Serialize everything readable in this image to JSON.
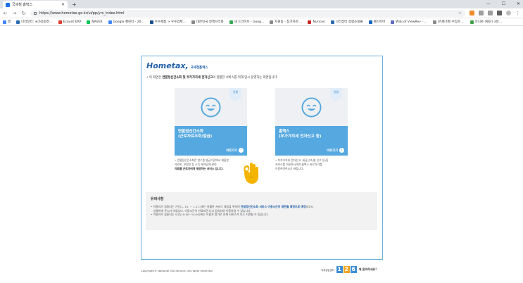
{
  "browser": {
    "tab_title": "국세청 홈택스",
    "new_tab": "+",
    "window_controls": [
      "—",
      "☐",
      "✕"
    ],
    "url": "https://www.hometax.go.kr/ui/pp/yrs_index.html",
    "bookmarks": [
      {
        "label": "앱",
        "color": "#4285f4"
      },
      {
        "label": "나라장터: 국가종합전...",
        "color": "#2b6cb0"
      },
      {
        "label": "Ecount ERP",
        "color": "#e03c31"
      },
      {
        "label": "NAVER",
        "color": "#03c75a"
      },
      {
        "label": "Google 캘린더 - 20...",
        "color": "#4285f4"
      },
      {
        "label": "우수제품 > 우수업체...",
        "color": "#1a4f8b"
      },
      {
        "label": "대한민국 정책브리핑",
        "color": "#888888"
      },
      {
        "label": "내 드라이브 - Goog...",
        "color": "#34a853"
      },
      {
        "label": "지원팀 - 참가자현 ...",
        "color": "#888888"
      },
      {
        "label": "Nuricon",
        "color": "#c62828"
      },
      {
        "label": "나라장터 종합쇼핑몰",
        "color": "#2b6cb0"
      },
      {
        "label": "퀘스피아",
        "color": "#1565c0"
      },
      {
        "label": "Wiki of ViewRev - ...",
        "color": "#5c6bc0"
      },
      {
        "label": "[카페 4월 수입차 ...",
        "color": "#888888"
      },
      {
        "label": "유니온 (재단) 3분...",
        "color": "#43a047"
      }
    ]
  },
  "logo": {
    "text": "Hometax,",
    "sub": "국세청홈택스"
  },
  "notice": {
    "prefix": "• 이 화면은 ",
    "bold": "연말정산간소화 및 부가가치세 전자신고",
    "suffix": "의 원활한 서비스를 위해 임시 운영하는 화면입니다."
  },
  "cards": [
    {
      "badge": "원활",
      "title_line1": "연말정산간소화",
      "title_line2": "(근로자료조회/발급)",
      "go_label": "바로가기",
      "desc_lines": [
        "• 연말정산간소화란 영수증 발급기관에서 제출한",
        "의료비, 보험료 등 소득·세액공제 관련",
        "자료를 근로자에게 제공하는 서비스 입니다."
      ]
    },
    {
      "badge": "원활",
      "title_line1": "홈택스",
      "title_line2": "(부가가치세 전자신고 등)",
      "go_label": "바로가기",
      "desc_lines": [
        "• 부가가치세 전자신고, 세금신고(불 신고 등)등",
        "서비스를 이용하시려면 홈택스 바로가기를",
        "이용하여주시기 바랍니다."
      ]
    }
  ],
  "caution": {
    "title": "유의사항",
    "line1_a": "• 이용자가 집중되는 기간(1. 15. ~ 1.17.)에는 원활한 서비스 제공을 위하여 ",
    "line1_hl": "연말정산간소화 서비스 이용시간이 제한될 예정으로 예정",
    "line1_b": "되오니",
    "line2": "양해하여 주시기 바랍니다. 이용시간이 만료되면 다시 접속하여 이용하실 수 있습니다.",
    "line3": "• 이용자가 집중되는 시간(10:00~14:00)에는 이용자 증가로 인해 서비스가 다소 지연될 수 있습니다."
  },
  "footer": {
    "copyright": "Copyright© National Tax Service. All rights reserved.",
    "call_label": "국세상담센터",
    "call_digits": [
      "1",
      "2",
      "6"
    ],
    "call_tail": "에 문의하세요!"
  }
}
